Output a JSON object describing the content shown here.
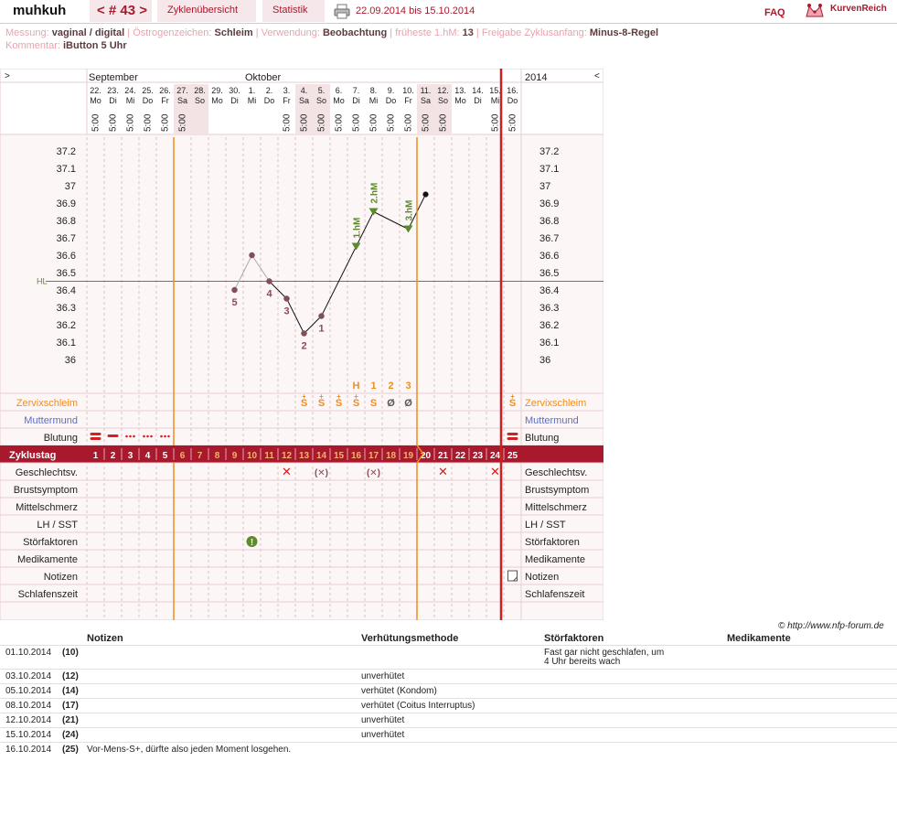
{
  "header": {
    "user": "muhkuh",
    "cycle_nav": "< # 43 >",
    "tab_overview": "Zyklenübersicht",
    "tab_stats": "Statistik",
    "range": "22.09.2014 bis 15.10.2014",
    "faq": "FAQ",
    "brand": "KurvenReich"
  },
  "meta": {
    "messung_label": "Messung:",
    "messung": "vaginal / digital",
    "oestro_label": "Östrogenzeichen:",
    "oestro": "Schleim",
    "verwendung_label": "Verwendung:",
    "verwendung": "Beobachtung",
    "hm_label": "früheste 1.hM:",
    "hm": "13",
    "freigabe_label": "Freigabe Zyklusanfang:",
    "freigabe": "Minus-8-Regel",
    "kommentar_label": "Kommentar:",
    "kommentar": "iButton 5 Uhr"
  },
  "colors": {
    "accent": "#a8192e",
    "orange": "#f08c1e",
    "red_line": "#cc1f1f",
    "green": "#5c8a2c",
    "blue": "#5a6fc4"
  },
  "chart_data": {
    "type": "line",
    "nav_left": ">",
    "nav_right": "<",
    "months": [
      {
        "label": "September",
        "col": 0
      },
      {
        "label": "Oktober",
        "col": 9
      }
    ],
    "year": "2014",
    "dates": [
      "22.",
      "23.",
      "24.",
      "25.",
      "26.",
      "27.",
      "28.",
      "29.",
      "30.",
      "1.",
      "2.",
      "3.",
      "4.",
      "5.",
      "6.",
      "7.",
      "8.",
      "9.",
      "10.",
      "11.",
      "12.",
      "13.",
      "14.",
      "15.",
      "16."
    ],
    "weekdays": [
      "Mo",
      "Di",
      "Mi",
      "Do",
      "Fr",
      "Sa",
      "So",
      "Mo",
      "Di",
      "Mi",
      "Do",
      "Fr",
      "Sa",
      "So",
      "Mo",
      "Di",
      "Mi",
      "Do",
      "Fr",
      "Sa",
      "So",
      "Mo",
      "Di",
      "Mi",
      "Do"
    ],
    "times": [
      "5:00",
      "5:00",
      "5:00",
      "5:00",
      "5:00",
      "5:00",
      "",
      "",
      "",
      "",
      "",
      "5:00",
      "5:00",
      "5:00",
      "5:00",
      "5:00",
      "5:00",
      "5:00",
      "5:00",
      "5:00",
      "5:00",
      "",
      "",
      "5:00",
      "5:00"
    ],
    "y_ticks": [
      "37.2",
      "37.1",
      "37",
      "36.9",
      "36.8",
      "36.7",
      "36.6",
      "36.5",
      "36.4",
      "36.3",
      "36.2",
      "36.1",
      "36"
    ],
    "ylim": [
      36.0,
      37.2
    ],
    "hl_label": "HL",
    "hl_value": 36.45,
    "temps": [
      null,
      null,
      null,
      null,
      null,
      null,
      null,
      null,
      36.4,
      36.6,
      36.45,
      36.35,
      36.15,
      36.25,
      null,
      36.65,
      36.85,
      null,
      36.75,
      36.95,
      null,
      null,
      null,
      null,
      null
    ],
    "low_labels": [
      {
        "col": 8,
        "text": "5"
      },
      {
        "col": 10,
        "text": "4"
      },
      {
        "col": 11,
        "text": "3"
      },
      {
        "col": 12,
        "text": "2"
      },
      {
        "col": 13,
        "text": "1"
      }
    ],
    "high_labels": [
      {
        "col": 15,
        "text": "1.hM"
      },
      {
        "col": 16,
        "text": "2.hM"
      },
      {
        "col": 18,
        "text": "3.hM"
      }
    ],
    "peak_marks": [
      {
        "col": 15,
        "text": "H"
      },
      {
        "col": 16,
        "text": "1"
      },
      {
        "col": 17,
        "text": "2"
      },
      {
        "col": 18,
        "text": "3"
      }
    ],
    "row_labels": [
      "Zervixschleim",
      "Muttermund",
      "Blutung",
      "Zyklustag",
      "Geschlechtsv.",
      "Brustsymptom",
      "Mittelschmerz",
      "LH / SST",
      "Störfaktoren",
      "Medikamente",
      "Notizen",
      "Schlafenszeit"
    ],
    "zervix": [
      {
        "col": 12,
        "text": "S+"
      },
      {
        "col": 13,
        "text": "S+"
      },
      {
        "col": 14,
        "text": "S+"
      },
      {
        "col": 15,
        "text": "S+"
      },
      {
        "col": 16,
        "text": "S"
      },
      {
        "col": 17,
        "text": "Ø"
      },
      {
        "col": 18,
        "text": "Ø"
      },
      {
        "col": 24,
        "text": "S+"
      }
    ],
    "blutung": [
      {
        "col": 0,
        "level": "heavy"
      },
      {
        "col": 1,
        "level": "medium"
      },
      {
        "col": 2,
        "level": "light"
      },
      {
        "col": 3,
        "level": "light"
      },
      {
        "col": 4,
        "level": "light"
      },
      {
        "col": 24,
        "level": "heavy"
      }
    ],
    "zyklustag": [
      "1",
      "2",
      "3",
      "4",
      "5",
      "6",
      "7",
      "8",
      "9",
      "10",
      "11",
      "12",
      "13",
      "14",
      "15",
      "16",
      "17",
      "18",
      "19",
      "20",
      "21",
      "22",
      "23",
      "24",
      "25"
    ],
    "gv": [
      {
        "col": 11,
        "text": "✕"
      },
      {
        "col": 13,
        "text": "(✕)"
      },
      {
        "col": 16,
        "text": "(✕)"
      },
      {
        "col": 20,
        "text": "✕"
      },
      {
        "col": 23,
        "text": "✕"
      }
    ],
    "stoer_col": 9,
    "notes_col": 24,
    "orange_lines": [
      5,
      19
    ],
    "red_line_col": 24
  },
  "notes": {
    "headers": [
      "Notizen",
      "Verhütungsmethode",
      "Störfaktoren",
      "Medikamente"
    ],
    "copyright": "© http://www.nfp-forum.de",
    "rows": [
      {
        "date": "01.10.2014",
        "day": "(10)",
        "note": "",
        "method": "",
        "stoer1": "Fast gar nicht geschlafen, um",
        "stoer2": "4 Uhr bereits wach"
      },
      {
        "date": "03.10.2014",
        "day": "(12)",
        "note": "",
        "method": "unverhütet",
        "stoer1": "",
        "stoer2": ""
      },
      {
        "date": "05.10.2014",
        "day": "(14)",
        "note": "",
        "method": "verhütet (Kondom)",
        "stoer1": "",
        "stoer2": ""
      },
      {
        "date": "08.10.2014",
        "day": "(17)",
        "note": "",
        "method": "verhütet (Coitus Interruptus)",
        "stoer1": "",
        "stoer2": ""
      },
      {
        "date": "12.10.2014",
        "day": "(21)",
        "note": "",
        "method": "unverhütet",
        "stoer1": "",
        "stoer2": ""
      },
      {
        "date": "15.10.2014",
        "day": "(24)",
        "note": "",
        "method": "unverhütet",
        "stoer1": "",
        "stoer2": ""
      },
      {
        "date": "16.10.2014",
        "day": "(25)",
        "note": "Vor-Mens-S+, dürfte also jeden Moment losgehen.",
        "method": "",
        "stoer1": "",
        "stoer2": ""
      }
    ]
  }
}
